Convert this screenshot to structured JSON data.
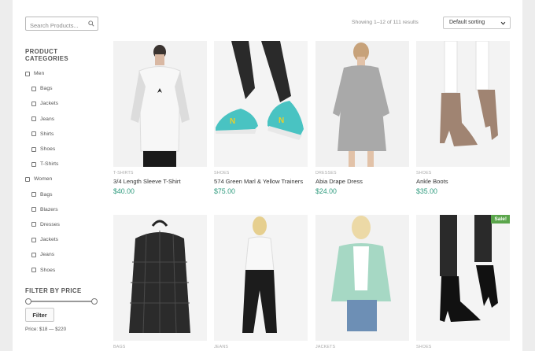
{
  "search": {
    "placeholder": "Search Products..."
  },
  "sidebar": {
    "categories_title": "Product Categories",
    "categories": [
      {
        "label": "Men",
        "level": 0
      },
      {
        "label": "Bags",
        "level": 1
      },
      {
        "label": "Jackets",
        "level": 1
      },
      {
        "label": "Jeans",
        "level": 1
      },
      {
        "label": "Shirts",
        "level": 1
      },
      {
        "label": "Shoes",
        "level": 1
      },
      {
        "label": "T-Shirts",
        "level": 1
      },
      {
        "label": "Women",
        "level": 0
      },
      {
        "label": "Bags",
        "level": 1
      },
      {
        "label": "Blazers",
        "level": 1
      },
      {
        "label": "Dresses",
        "level": 1
      },
      {
        "label": "Jackets",
        "level": 1
      },
      {
        "label": "Jeans",
        "level": 1
      },
      {
        "label": "Shoes",
        "level": 1
      }
    ],
    "price_title": "Filter by Price",
    "filter_button": "Filter",
    "price_range": "Price: $18 — $220"
  },
  "toolbar": {
    "result_count": "Showing 1–12 of 111 results",
    "sorting": "Default sorting"
  },
  "products": [
    {
      "category": "T-Shirts",
      "name": "3/4 Length Sleeve T-Shirt",
      "price": "$40.00"
    },
    {
      "category": "Shoes",
      "name": "574 Green Marl & Yellow Trainers",
      "price": "$75.00"
    },
    {
      "category": "Dresses",
      "name": "Abia Drape Dress",
      "price": "$24.00"
    },
    {
      "category": "Shoes",
      "name": "Ankle Boots",
      "price": "$35.00"
    },
    {
      "category": "Bags",
      "name": "",
      "price": ""
    },
    {
      "category": "Jeans",
      "name": "",
      "price": ""
    },
    {
      "category": "Jackets",
      "name": "",
      "price": ""
    },
    {
      "category": "Shoes",
      "name": "",
      "price": "",
      "badge": "Sale!"
    }
  ],
  "colors": {
    "price": "#2f9b7e",
    "sale_badge": "#5aa54b"
  }
}
